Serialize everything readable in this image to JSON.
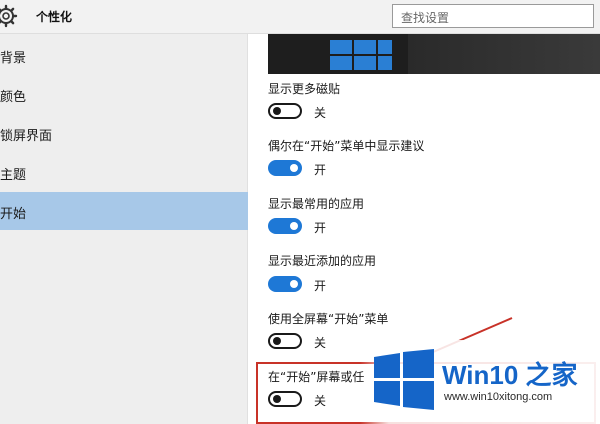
{
  "header": {
    "title": "个性化",
    "search_placeholder": "查找设置",
    "icon": "gear-icon"
  },
  "sidebar": {
    "items": [
      {
        "label": "背景"
      },
      {
        "label": "颜色"
      },
      {
        "label": "锁屏界面"
      },
      {
        "label": "主题"
      },
      {
        "label": "开始",
        "active": true
      }
    ]
  },
  "settings": [
    {
      "label": "显示更多磁贴",
      "state": "关",
      "on": false
    },
    {
      "label": "偶尔在“开始”菜单中显示建议",
      "state": "开",
      "on": true
    },
    {
      "label": "显示最常用的应用",
      "state": "开",
      "on": true
    },
    {
      "label": "显示最近添加的应用",
      "state": "开",
      "on": true
    },
    {
      "label": "使用全屏幕“开始”菜单",
      "state": "关",
      "on": false
    },
    {
      "label": "在“开始”屏幕或任",
      "state": "关",
      "on": false
    }
  ],
  "watermark": {
    "title": "Win10 之家",
    "url": "www.win10xitong.com"
  },
  "colors": {
    "accent": "#1e78d6",
    "sidebar_active": "#a7c8e8",
    "highlight": "#c83228",
    "watermark_blue": "#1565c8"
  }
}
